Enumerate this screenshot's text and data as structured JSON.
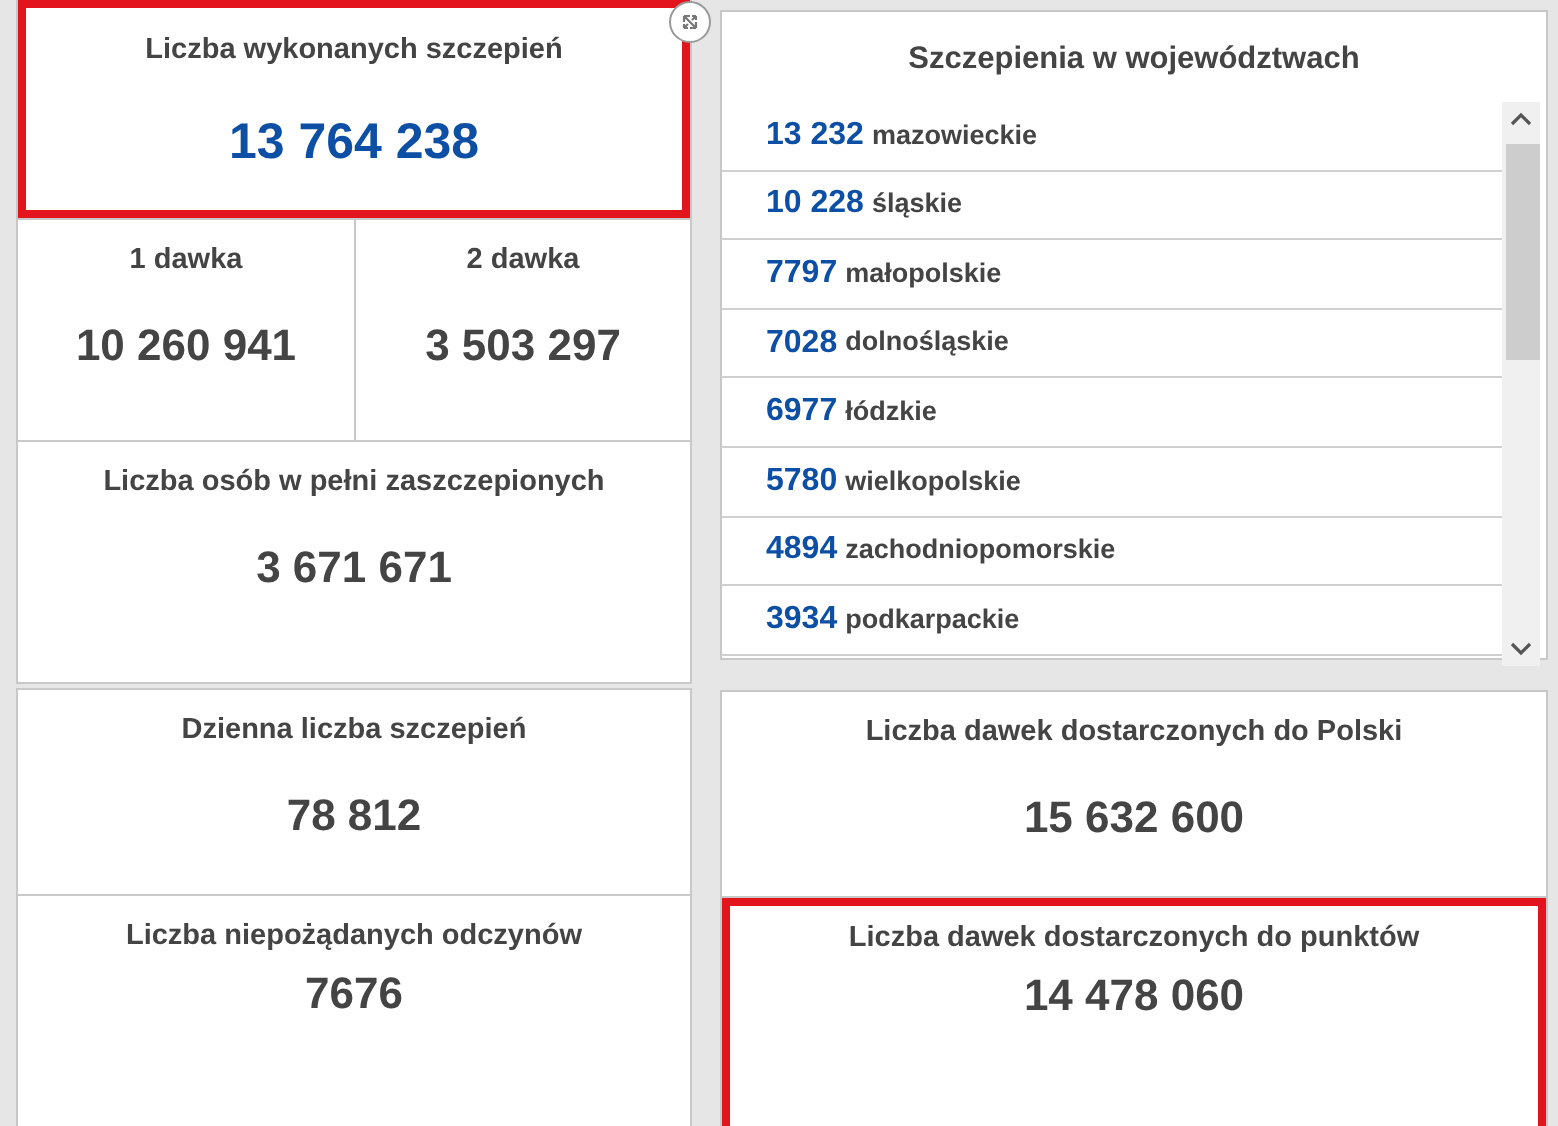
{
  "left_tiles": [
    {
      "kind": "total",
      "label": "Liczba wykonanych szczepień",
      "value": "13 764 238",
      "highlighted": true
    },
    {
      "kind": "split",
      "parts": [
        {
          "label": "1 dawka",
          "value": "10 260 941"
        },
        {
          "label": "2 dawka",
          "value": "3 503 297"
        }
      ],
      "highlighted": false
    },
    {
      "kind": "stat",
      "label": "Liczba osób w pełni zaszczepionych",
      "value": "3 671 671",
      "highlighted": false
    },
    {
      "kind": "stat",
      "label": "Dzienna liczba szczepień",
      "value": "78 812",
      "highlighted": false
    },
    {
      "kind": "compact",
      "label": "Liczba niepożądanych odczynów",
      "value": "7676",
      "highlighted": false
    }
  ],
  "province_list": {
    "title": "Szczepienia w województwach",
    "items": [
      {
        "value": "13 232",
        "name": "mazowieckie"
      },
      {
        "value": "10 228",
        "name": "śląskie"
      },
      {
        "value": "7797",
        "name": "małopolskie"
      },
      {
        "value": "7028",
        "name": "dolnośląskie"
      },
      {
        "value": "6977",
        "name": "łódzkie"
      },
      {
        "value": "5780",
        "name": "wielkopolskie"
      },
      {
        "value": "4894",
        "name": "zachodniopomorskie"
      },
      {
        "value": "3934",
        "name": "podkarpackie"
      }
    ]
  },
  "right_tiles": [
    {
      "kind": "stat",
      "label": "Liczba dawek dostarczonych do Polski",
      "value": "15 632 600",
      "highlighted": false
    },
    {
      "kind": "compact",
      "label": "Liczba dawek dostarczonych do punktów",
      "value": "14 478 060",
      "highlighted": true
    }
  ]
}
